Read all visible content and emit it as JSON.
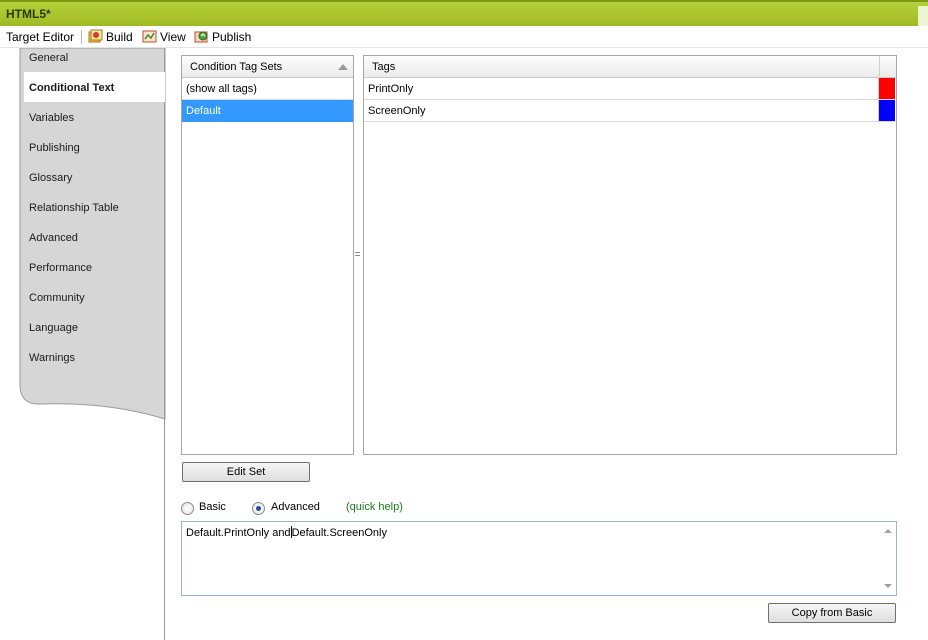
{
  "window": {
    "title": "HTML5*"
  },
  "toolbar": {
    "editor_label": "Target Editor",
    "build_label": "Build",
    "view_label": "View",
    "publish_label": "Publish"
  },
  "nav": {
    "items": [
      {
        "label": "General"
      },
      {
        "label": "Conditional Text",
        "active": true
      },
      {
        "label": "Variables"
      },
      {
        "label": "Publishing"
      },
      {
        "label": "Glossary"
      },
      {
        "label": "Relationship Table"
      },
      {
        "label": "Advanced"
      },
      {
        "label": "Performance"
      },
      {
        "label": "Community"
      },
      {
        "label": "Language"
      },
      {
        "label": "Warnings"
      }
    ]
  },
  "tag_sets": {
    "header": "Condition Tag Sets",
    "rows": [
      {
        "label": "(show all tags)"
      },
      {
        "label": "Default",
        "selected": true
      }
    ]
  },
  "tags": {
    "header": "Tags",
    "rows": [
      {
        "label": "PrintOnly",
        "color": "#ff0000"
      },
      {
        "label": "ScreenOnly",
        "color": "#0000ff"
      }
    ]
  },
  "edit_set_label": "Edit Set",
  "mode": {
    "basic_label": "Basic",
    "advanced_label": "Advanced",
    "selected": "Advanced",
    "quick_help_label": "(quick help)"
  },
  "expression": {
    "before_caret": "Default.PrintOnly and",
    "after_caret": "Default.ScreenOnly"
  },
  "copy_from_basic_label": "Copy from Basic",
  "colors": {
    "title_bar": "#a9c42c",
    "selection": "#3399ff",
    "nav_background": "#d6d6d6",
    "quick_help": "#1a7a1a"
  }
}
